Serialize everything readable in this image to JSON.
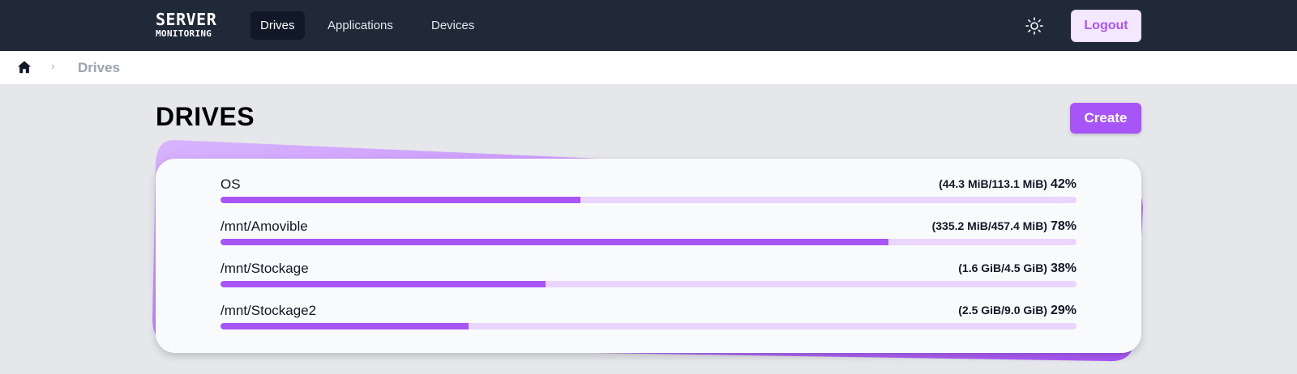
{
  "header": {
    "logo_line1": "SERVER",
    "logo_line2": "MONITORING",
    "nav": [
      {
        "label": "Drives",
        "active": true
      },
      {
        "label": "Applications",
        "active": false
      },
      {
        "label": "Devices",
        "active": false
      }
    ],
    "theme_icon": "sun-icon",
    "logout_label": "Logout"
  },
  "breadcrumb": {
    "home_icon": "home-icon",
    "separator_icon": "chevron-right-icon",
    "separator": "›",
    "current": "Drives"
  },
  "page": {
    "title": "DRIVES",
    "create_label": "Create"
  },
  "drives": [
    {
      "name": "OS",
      "usage": "(44.3 MiB/113.1 MiB)",
      "percent_label": "42%",
      "percent": 42
    },
    {
      "name": "/mnt/Amovible",
      "usage": "(335.2 MiB/457.4 MiB)",
      "percent_label": "78%",
      "percent": 78
    },
    {
      "name": "/mnt/Stockage",
      "usage": "(1.6 GiB/4.5 GiB)",
      "percent_label": "38%",
      "percent": 38
    },
    {
      "name": "/mnt/Stockage2",
      "usage": "(2.5 GiB/9.0 GiB)",
      "percent_label": "29%",
      "percent": 29
    }
  ],
  "colors": {
    "accent": "#a855f7",
    "accent_light": "#e9d5ff",
    "navbar": "#1f2937"
  }
}
